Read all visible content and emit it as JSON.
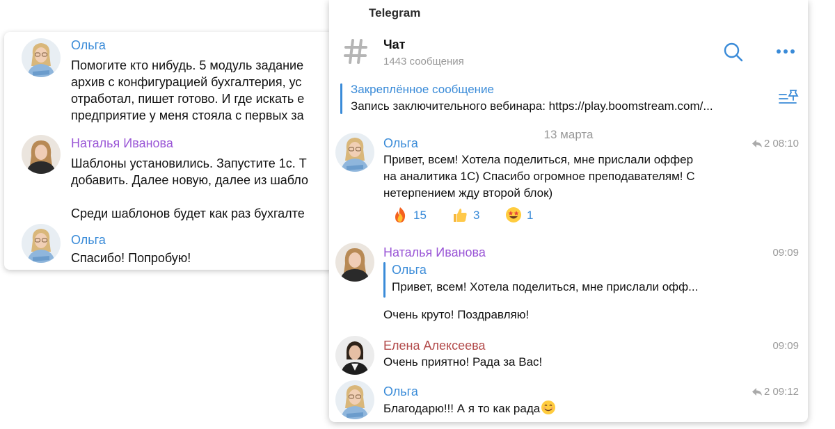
{
  "back_card": {
    "messages": [
      {
        "author": "Ольга",
        "text": "Помогите кто нибудь. 5 модуль задание\nархив с конфигурацией бухгалтерия, ус\nотработал, пишет готово. И где искать е\nпредприятие у меня стояла с первых за"
      },
      {
        "author": "Наталья Иванова",
        "text": "Шаблоны установились. Запустите 1с. Т\nдобавить. Далее новую, далее из шабло\n\nСреди шаблонов будет как раз бухгалте"
      },
      {
        "author": "Ольга",
        "text": "Спасибо! Попробую!"
      }
    ]
  },
  "window": {
    "app_title": "Telegram",
    "chat_title": "Чат",
    "chat_count": "1443 сообщения",
    "pinned": {
      "title": "Закреплённое сообщение",
      "text": "Запись заключительного вебинара: https://play.boomstream.com/..."
    },
    "date_separator": "13 марта",
    "messages": [
      {
        "author": "Ольга",
        "meta": "2 08:10",
        "text": "Привет, всем! Хотела поделиться, мне прислали оффер\nна аналитика 1С) Спасибо огромное преподавателям! С\nнетерпением жду второй блок)",
        "reactions": [
          {
            "emoji": "fire-icon",
            "count": "15"
          },
          {
            "emoji": "thumbs-up-icon",
            "count": "3"
          },
          {
            "emoji": "star-struck-icon",
            "count": "1"
          }
        ]
      },
      {
        "author": "Наталья Иванова",
        "time": "09:09",
        "quote": {
          "author": "Ольга",
          "text": "Привет, всем! Хотела поделиться, мне прислали офф..."
        },
        "text": "Очень круто! Поздравляю!"
      },
      {
        "author": "Елена Алексеева",
        "time": "09:09",
        "text": "Очень приятно! Рада за Вас!"
      },
      {
        "author": "Ольга",
        "meta": "2 09:12",
        "text": "Благодарю!!! А я то как рада"
      }
    ]
  },
  "colors": {
    "accent": "#3a8bd8",
    "name_olga": "#3a8bd8",
    "name_natalia": "#9a56d6",
    "name_elena": "#b24a4a",
    "muted": "#999999"
  }
}
